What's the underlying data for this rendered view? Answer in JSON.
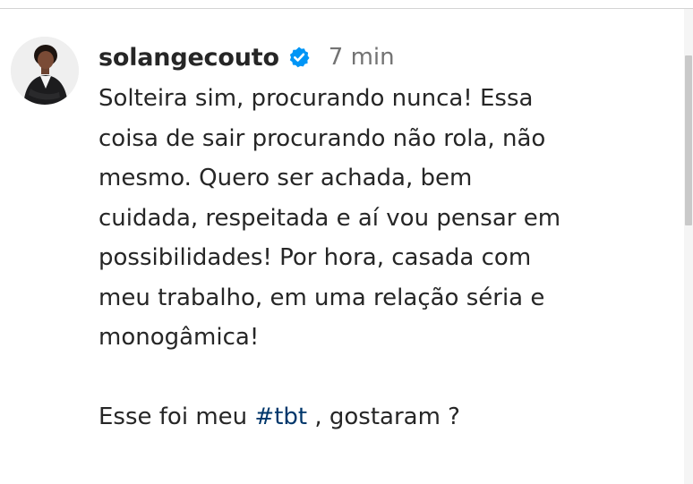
{
  "comment": {
    "username": "solangecouto",
    "timestamp": "7 min",
    "caption_lines": [
      "Solteira sim, procurando nunca! Essa",
      "coisa de sair procurando não rola, não",
      "mesmo. Quero ser achada, bem",
      "cuidada, respeitada e aí vou pensar em",
      "possibilidades! Por hora, casada com",
      "meu trabalho, em uma relação séria e",
      "monogâmica!"
    ],
    "last_line_prefix": "Esse foi meu ",
    "hashtag": "#tbt",
    "last_line_suffix": " , gostaram ?"
  },
  "icons": {
    "verified": "verified-badge-icon",
    "avatar": "profile-photo"
  },
  "colors": {
    "text": "#262626",
    "timestamp": "#737373",
    "verified_badge": "#0095f6",
    "hashtag": "#00376b"
  }
}
